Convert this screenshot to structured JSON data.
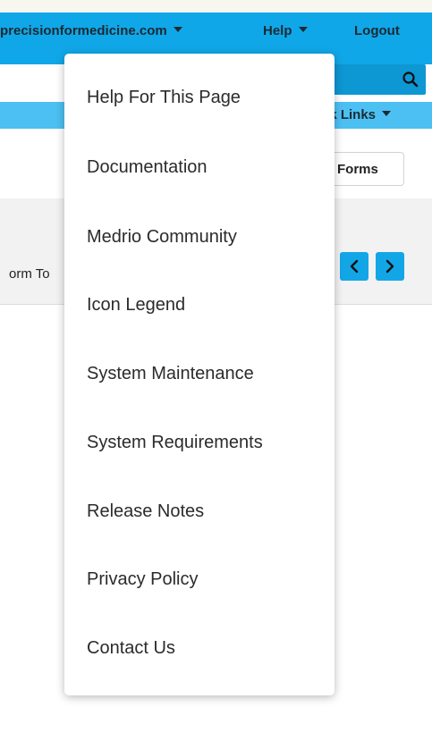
{
  "header": {
    "domain_label": "precisionformedicine.com",
    "help_label": "Help",
    "logout_label": "Logout",
    "brand_color": "#10a7e8"
  },
  "search": {
    "icon": "search-icon"
  },
  "subnav": {
    "quick_links_label": "ck Links"
  },
  "toolbar": {
    "forms_label": "Forms"
  },
  "panel": {
    "label": "orm To",
    "prev_icon": "chevron-left-icon",
    "next_icon": "chevron-right-icon"
  },
  "help_menu": {
    "items": [
      {
        "label": "Help For This Page"
      },
      {
        "label": "Documentation"
      },
      {
        "label": "Medrio Community"
      },
      {
        "label": "Icon Legend"
      },
      {
        "label": "System Maintenance"
      },
      {
        "label": "System Requirements"
      },
      {
        "label": "Release Notes"
      },
      {
        "label": "Privacy Policy"
      },
      {
        "label": "Contact Us"
      }
    ]
  }
}
